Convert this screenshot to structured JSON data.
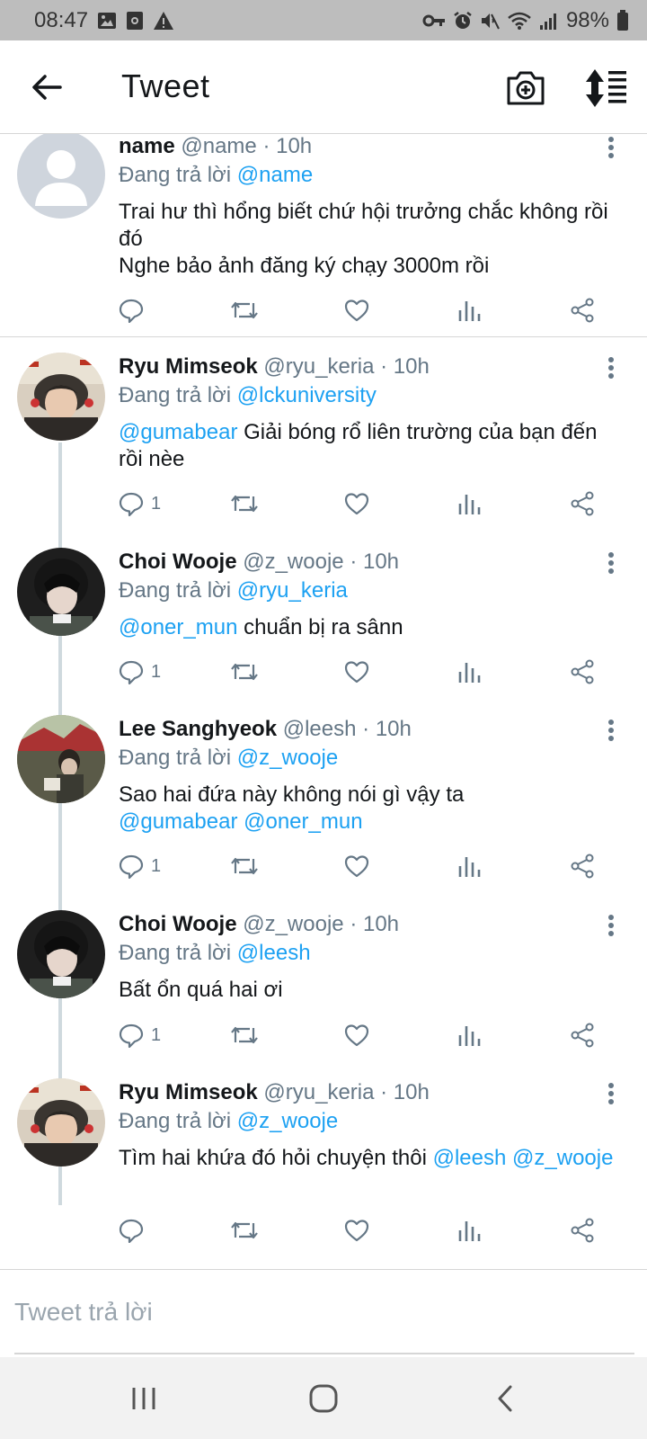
{
  "status_bar": {
    "time": "08:47",
    "battery": "98%"
  },
  "header": {
    "title": "Tweet"
  },
  "tweets": [
    {
      "name": "name",
      "handle": "@name",
      "time": "· 10h",
      "replying_label": "Đang trả lời",
      "replying_to": "@name",
      "text_line1": "Trai hư thì hổng biết chứ hội trưởng chắc không rồi đó",
      "text_line2": "Nghe bảo ảnh đăng ký chạy 3000m rồi",
      "reply_count": ""
    },
    {
      "name": "Ryu Mimseok",
      "handle": "@ryu_keria",
      "time": "· 10h",
      "replying_label": "Đang trả lời",
      "replying_to": "@lckuniversity",
      "mention1": "@gumabear",
      "text": "Giải bóng rổ liên trường của bạn đến rồi nèe",
      "reply_count": "1"
    },
    {
      "name": "Choi Wooje",
      "handle": "@z_wooje",
      "time": "· 10h",
      "replying_label": "Đang trả lời",
      "replying_to": "@ryu_keria",
      "mention1": "@oner_mun",
      "text": "chuẩn bị ra sânn",
      "reply_count": "1"
    },
    {
      "name": "Lee Sanghyeok",
      "handle": "@leesh",
      "time": "· 10h",
      "replying_label": "Đang trả lời",
      "replying_to": "@z_wooje",
      "text": "Sao hai đứa này không nói gì vậy ta",
      "mention1": "@gumabear",
      "mention2": "@oner_mun",
      "reply_count": "1"
    },
    {
      "name": "Choi Wooje",
      "handle": "@z_wooje",
      "time": "· 10h",
      "replying_label": "Đang trả lời",
      "replying_to": "@leesh",
      "text": "Bất ổn quá hai ơi",
      "reply_count": "1"
    },
    {
      "name": "Ryu Mimseok",
      "handle": "@ryu_keria",
      "time": "· 10h",
      "replying_label": "Đang trả lời",
      "replying_to": "@z_wooje",
      "text": "Tìm hai khứa đó hỏi chuyện thôi",
      "mention1": "@leesh",
      "mention2": "@z_wooje",
      "reply_count": ""
    }
  ],
  "reply_bar": {
    "placeholder": "Tweet trả lời"
  },
  "colors": {
    "accent": "#1da1f2",
    "secondary_text": "#657786",
    "status_bar": "#bdbdbd"
  },
  "icons": {
    "status": [
      "image-icon",
      "screen-record-icon",
      "warning-icon",
      "vpn-key-icon",
      "alarm-icon",
      "mute-icon",
      "wifi-icon",
      "signal-icon",
      "battery-icon"
    ],
    "header": [
      "back-arrow-icon",
      "camera-plus-icon",
      "sort-icon"
    ],
    "tweet_actions": [
      "reply-icon",
      "retweet-icon",
      "like-icon",
      "analytics-icon",
      "share-icon"
    ],
    "navigation": [
      "recent-apps-icon",
      "home-icon",
      "back-icon"
    ]
  }
}
